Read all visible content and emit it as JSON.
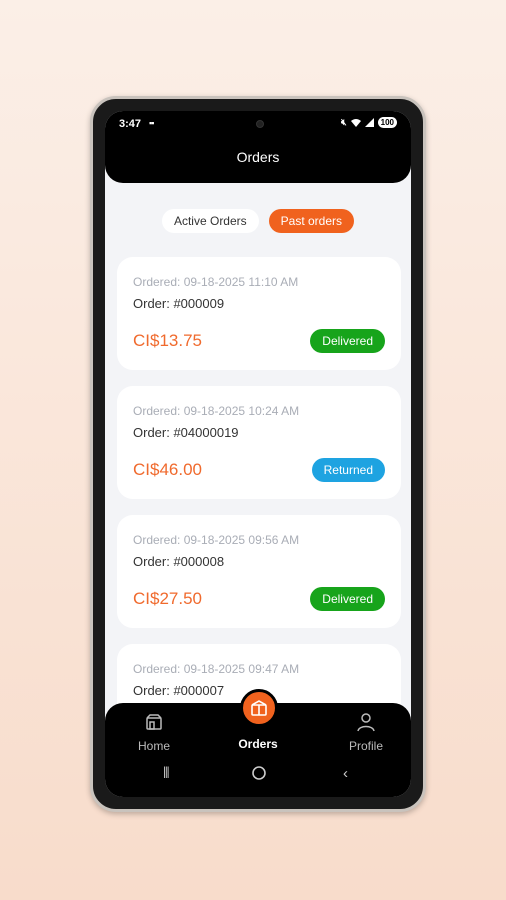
{
  "status_bar": {
    "time": "3:47",
    "battery": "100"
  },
  "header": {
    "title": "Orders"
  },
  "tabs": [
    {
      "label": "Active Orders",
      "active": false
    },
    {
      "label": "Past orders",
      "active": true
    }
  ],
  "orders": [
    {
      "date": "Ordered: 09-18-2025 11:10 AM",
      "number": "Order: #000009",
      "price": "CI$13.75",
      "status": "Delivered",
      "status_color": "#17a41b"
    },
    {
      "date": "Ordered: 09-18-2025 10:24 AM",
      "number": "Order: #04000019",
      "price": "CI$46.00",
      "status": "Returned",
      "status_color": "#1ea3e1"
    },
    {
      "date": "Ordered: 09-18-2025 09:56 AM",
      "number": "Order: #000008",
      "price": "CI$27.50",
      "status": "Delivered",
      "status_color": "#17a41b"
    },
    {
      "date": "Ordered: 09-18-2025 09:47 AM",
      "number": "Order: #000007",
      "price": "",
      "status": "",
      "status_color": ""
    }
  ],
  "bottom_nav": [
    {
      "label": "Home",
      "icon": "home-store-icon",
      "active": false
    },
    {
      "label": "Orders",
      "icon": "orders-box-icon",
      "active": true
    },
    {
      "label": "Profile",
      "icon": "profile-person-icon",
      "active": false
    }
  ],
  "colors": {
    "accent": "#f0621e",
    "price": "#f06a2d"
  }
}
